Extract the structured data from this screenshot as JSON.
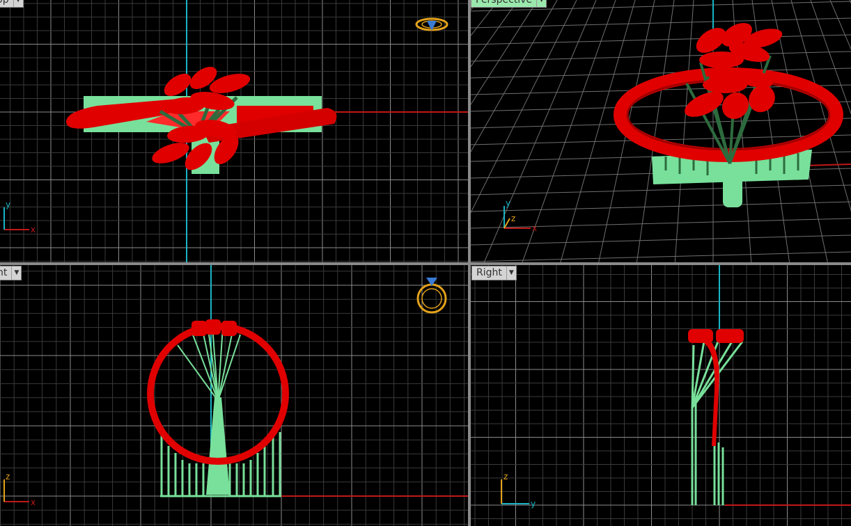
{
  "viewports": {
    "top": {
      "label": "Top",
      "axes": {
        "h": "x",
        "v": "y"
      }
    },
    "perspective": {
      "label": "Perspective",
      "axes": {
        "h": "x",
        "v": "y",
        "z": "z"
      }
    },
    "front": {
      "label": "Front",
      "axes": {
        "h": "x",
        "v": "z"
      }
    },
    "right": {
      "label": "Right",
      "axes": {
        "h": "y",
        "v": "z"
      }
    }
  },
  "icons": {
    "gizmo": "ring-view-cube-icon"
  },
  "colors": {
    "background": "#000000",
    "grid_minor": "#3a3a3a",
    "grid_major": "#8c8c8c",
    "axis_x": "#c01818",
    "axis_y": "#19b5c5",
    "model": "#e00000",
    "supports": "#78e09a",
    "gizmo": "#e3a21a",
    "gem": "#3a7bd5"
  }
}
